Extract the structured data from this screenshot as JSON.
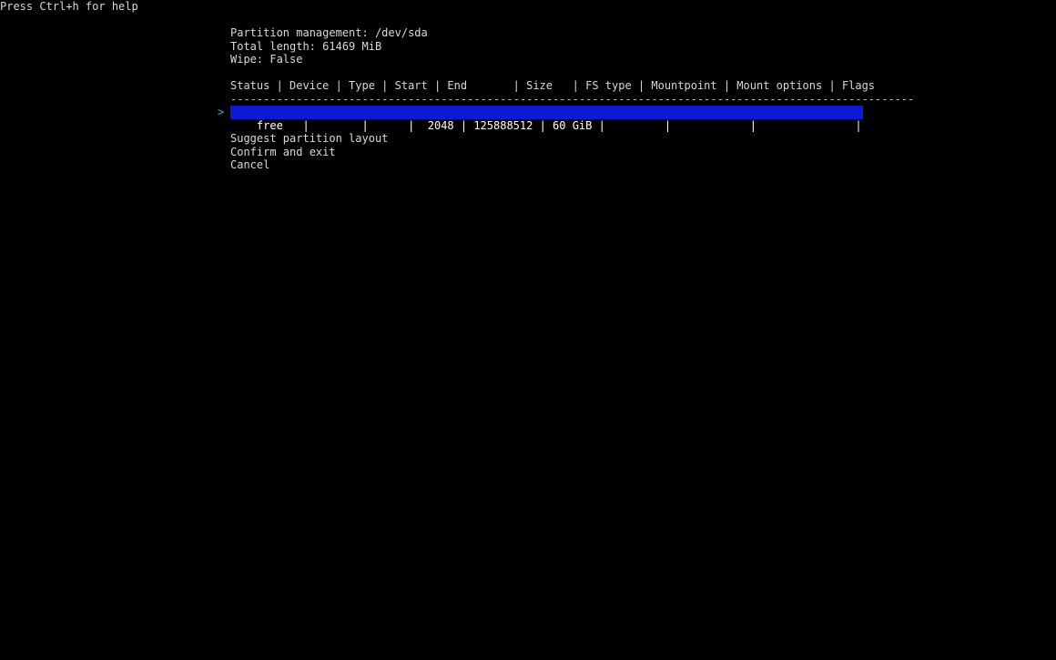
{
  "help_text": "Press Ctrl+h for help",
  "header": {
    "title": "Partition management: /dev/sda",
    "total_length": "Total length: 61469 MiB",
    "wipe": "Wipe: False"
  },
  "table": {
    "header_line": "Status | Device | Type | Start | End       | Size   | FS type | Mountpoint | Mount options | Flags",
    "separator": "--------------------------------------------------------------------------------------------------------",
    "columns": [
      "Status",
      "Device",
      "Type",
      "Start",
      "End",
      "Size",
      "FS type",
      "Mountpoint",
      "Mount options",
      "Flags"
    ],
    "cursor": ">",
    "rows": [
      {
        "status": "free",
        "device": "",
        "type": "",
        "start": "2048",
        "end": "125888512",
        "size": "60 GiB",
        "fs_type": "",
        "mountpoint": "",
        "mount_options": "",
        "flags": "",
        "line": "free   |        |      |  2048 | 125888512 | 60 GiB |         |            |               |",
        "selected": true
      }
    ]
  },
  "menu": {
    "items": [
      "Suggest partition layout",
      "Confirm and exit",
      "Cancel"
    ]
  },
  "colors": {
    "background": "#000000",
    "text": "#d8d8d8",
    "selection_bg": "#0c1ad6",
    "cursor": "#3fb5c4"
  }
}
